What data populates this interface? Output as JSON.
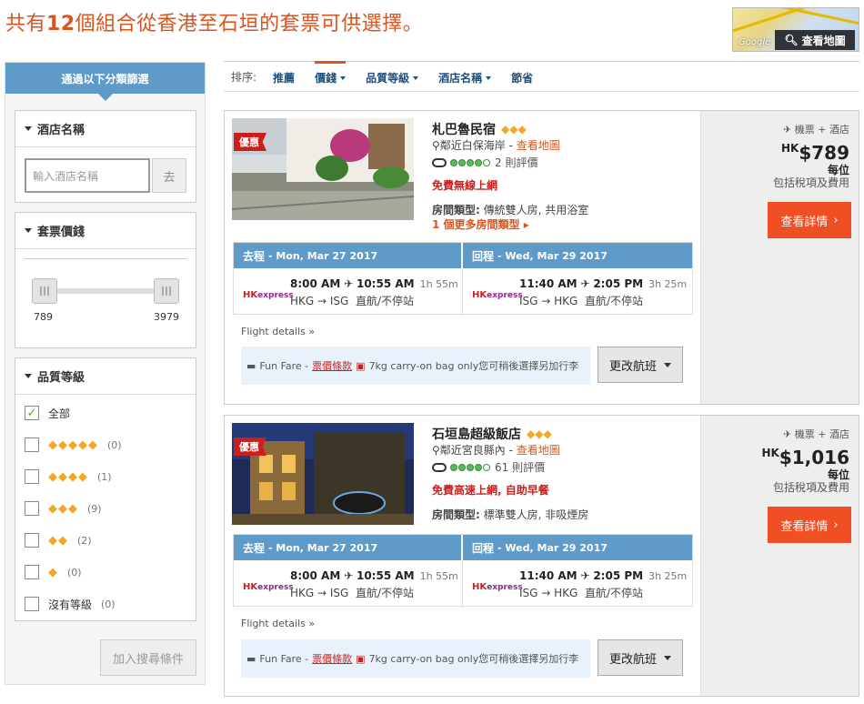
{
  "headline": {
    "prefix": "共有",
    "count": "12",
    "suffix": "個組合從香港至石垣的套票可供選擇。"
  },
  "map": {
    "button_label": "查看地圖",
    "brand": "Google"
  },
  "sidebar": {
    "header": "通過以下分類篩選",
    "hotel_name": {
      "title": "酒店名稱",
      "placeholder": "輸入酒店名稱",
      "go": "去"
    },
    "price": {
      "title": "套票價錢",
      "min": "789",
      "max": "3979"
    },
    "rating": {
      "title": "品質等級",
      "options": [
        {
          "label": "全部",
          "count": "",
          "checked": true
        },
        {
          "stars": "◆◆◆◆◆",
          "count": "(0)"
        },
        {
          "stars": "◆◆◆◆",
          "count": "(1)"
        },
        {
          "stars": "◆◆◆",
          "count": "(9)"
        },
        {
          "stars": "◆◆",
          "count": "(2)"
        },
        {
          "stars": "◆",
          "count": "(0)"
        },
        {
          "label": "沒有等級",
          "count": "(0)"
        }
      ]
    },
    "add_button": "加入搜尋條件"
  },
  "sort": {
    "label": "排序:",
    "options": [
      "推薦",
      "價錢",
      "品質等級",
      "酒店名稱",
      "節省"
    ]
  },
  "cards": [
    {
      "badge": "優惠",
      "name": "札巴魯民宿",
      "stars": "◆◆◆",
      "location": "鄰近白保海岸",
      "map_link": "查看地圖",
      "reviews": "2 則評價",
      "perk": "免費無線上網",
      "room_label": "房間類型:",
      "room_value": "傳統雙人房, 共用浴室",
      "more_rooms": "1 個更多房間類型",
      "outbound": {
        "label": "去程",
        "date": "- Mon, Mar 27 2017",
        "dep": "8:00 AM",
        "arr": "10:55 AM",
        "dur": "1h 55m",
        "route": "HKG → ISG",
        "type": "直航/不停站"
      },
      "inbound": {
        "label": "回程",
        "date": "- Wed, Mar 29 2017",
        "dep": "11:40 AM",
        "arr": "2:05 PM",
        "dur": "3h 25m",
        "route": "ISG → HKG",
        "type": "直航/不停站"
      },
      "airline": "express",
      "flight_details": "Flight details",
      "fare_name": "Fun Fare -",
      "fare_link": "票價條款",
      "bag": "7kg carry-on bag only您可稍後選擇另加行李",
      "change_btn": "更改航班",
      "package": "機票 + 酒店",
      "currency": "HK",
      "price": "$789",
      "per": "每位",
      "tax": "包括稅項及費用",
      "view_btn": "查看詳情"
    },
    {
      "badge": "優惠",
      "name": "石垣島超級飯店",
      "stars": "◆◆◆",
      "location": "鄰近宮良縣內",
      "map_link": "查看地圖",
      "reviews": "61 則評價",
      "perk": "免費高速上網, 自助早餐",
      "room_label": "房間類型:",
      "room_value": "標準雙人房, 非吸煙房",
      "more_rooms": "",
      "outbound": {
        "label": "去程",
        "date": "- Mon, Mar 27 2017",
        "dep": "8:00 AM",
        "arr": "10:55 AM",
        "dur": "1h 55m",
        "route": "HKG → ISG",
        "type": "直航/不停站"
      },
      "inbound": {
        "label": "回程",
        "date": "- Wed, Mar 29 2017",
        "dep": "11:40 AM",
        "arr": "2:05 PM",
        "dur": "3h 25m",
        "route": "ISG → HKG",
        "type": "直航/不停站"
      },
      "airline": "express",
      "flight_details": "Flight details",
      "fare_name": "Fun Fare -",
      "fare_link": "票價條款",
      "bag": "7kg carry-on bag only您可稍後選擇另加行李",
      "change_btn": "更改航班",
      "package": "機票 + 酒店",
      "currency": "HK",
      "price": "$1,016",
      "per": "每位",
      "tax": "包括稅項及費用",
      "view_btn": "查看詳情"
    }
  ]
}
